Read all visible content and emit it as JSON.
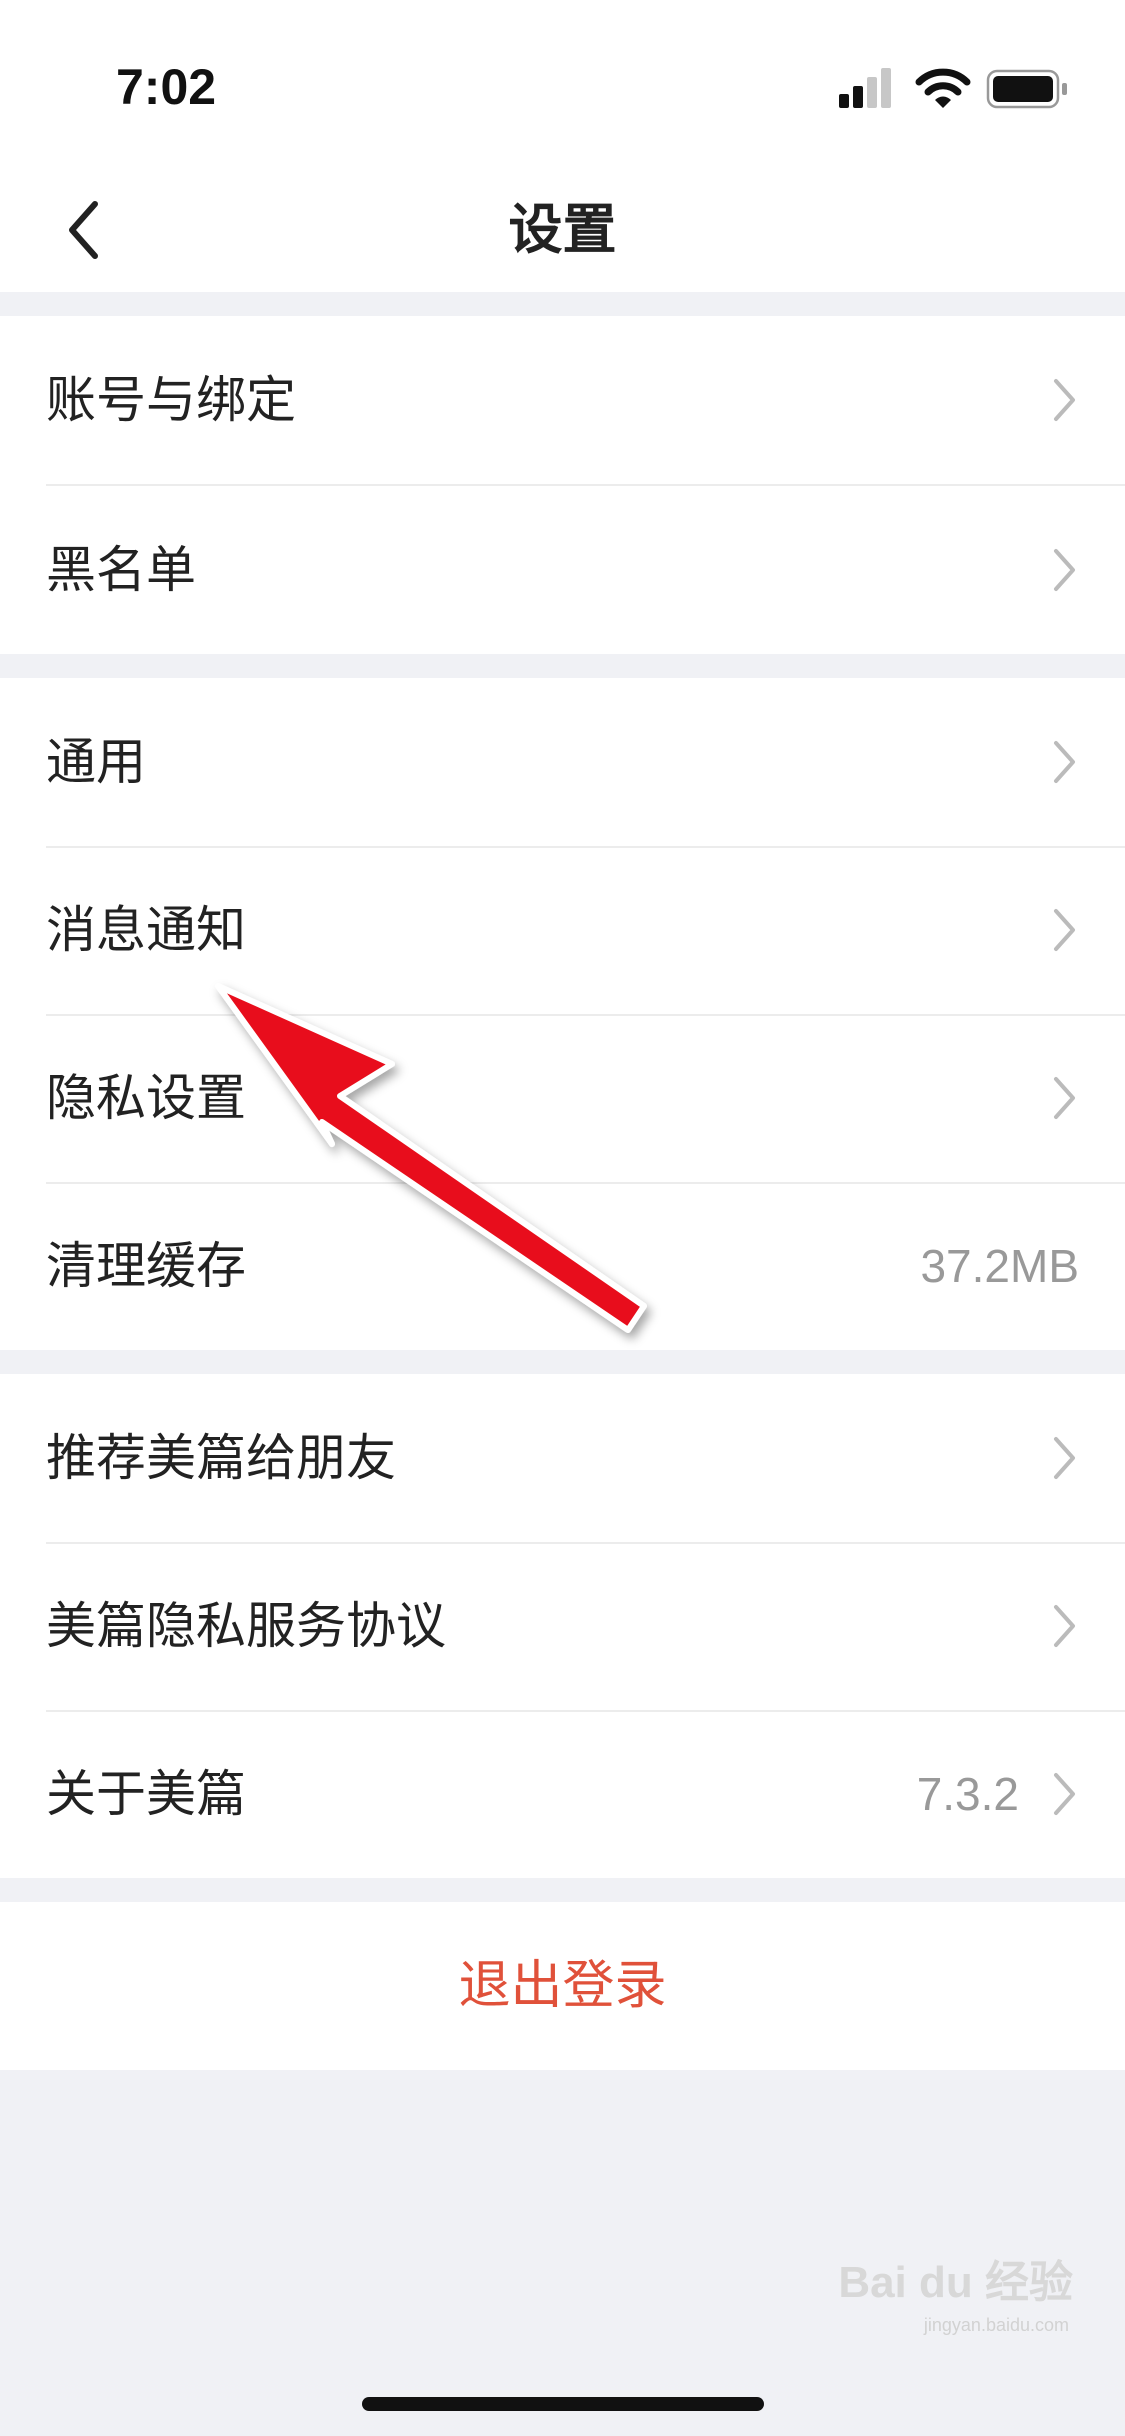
{
  "status_bar": {
    "time": "7:02"
  },
  "nav": {
    "title": "设置"
  },
  "groups": [
    {
      "items": [
        {
          "label": "账号与绑定"
        },
        {
          "label": "黑名单"
        }
      ]
    },
    {
      "items": [
        {
          "label": "通用"
        },
        {
          "label": "消息通知"
        },
        {
          "label": "隐私设置"
        },
        {
          "label": "清理缓存",
          "value": "37.2MB"
        }
      ]
    },
    {
      "items": [
        {
          "label": "推荐美篇给朋友"
        },
        {
          "label": "美篇隐私服务协议"
        },
        {
          "label": "关于美篇",
          "value": "7.3.2"
        }
      ]
    }
  ],
  "logout": {
    "label": "退出登录"
  },
  "watermark": {
    "brand": "Bai du 经验",
    "url": "jingyan.baidu.com"
  },
  "colors": {
    "logout_red": "#e0513a",
    "arrow_red": "#e8101a",
    "background": "#f0f1f5"
  }
}
